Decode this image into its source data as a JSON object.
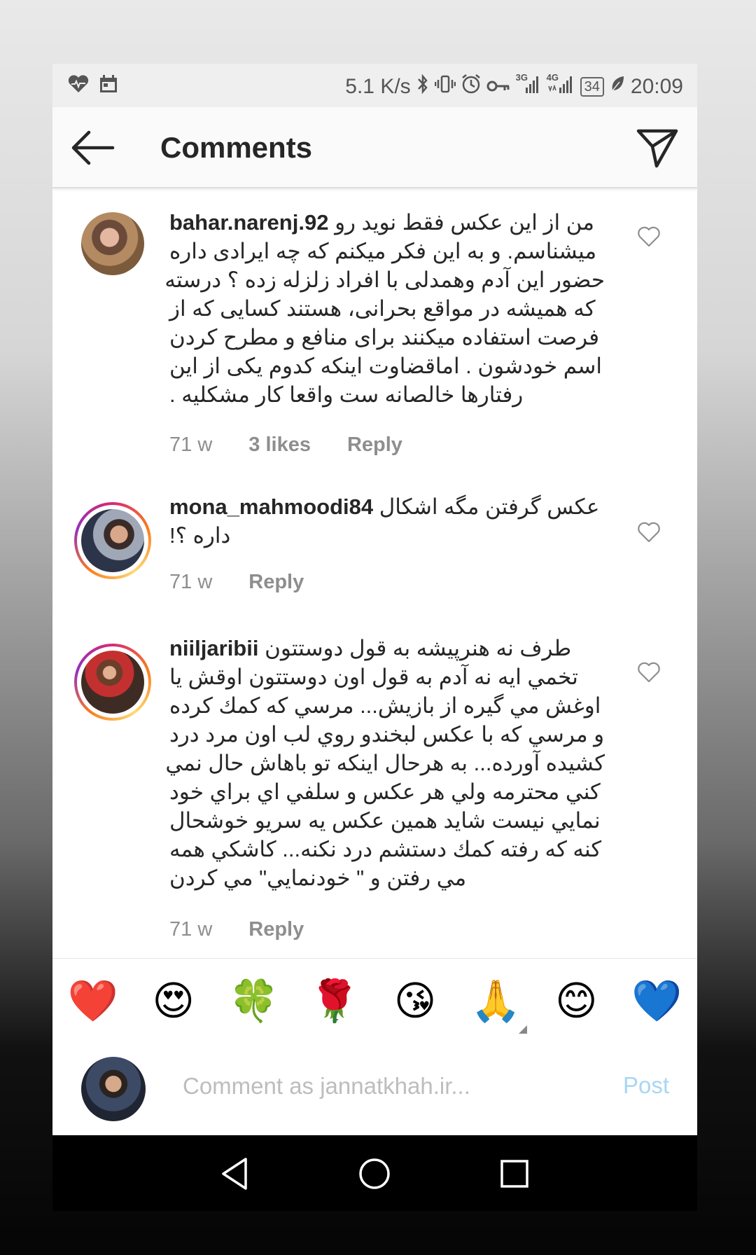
{
  "status_bar": {
    "speed": "5.1 K/s",
    "network_3g": "3G",
    "network_4g": "4G",
    "battery": "34",
    "time": "20:09"
  },
  "header": {
    "title": "Comments"
  },
  "comments": [
    {
      "username": "bahar.narenj.92",
      "lines": [
        "من از این عکس فقط نوید رو",
        "میشناسم. و به این فکر میکنم که چه ایرادی داره",
        "حضور این آدم وهمدلی با افراد زلزله زده ؟ درسته",
        "که همیشه در مواقع بحرانی، هستند کسایی که از",
        "فرصت استفاده میکنند برای منافع  و مطرح کردن",
        "اسم خودشون . اماقضاوت اینکه کدوم یکی از این",
        "رفتارها خالصانه ست واقعا کار مشکلیه ."
      ],
      "time": "71 w",
      "likes": "3 likes",
      "reply": "Reply"
    },
    {
      "username": "mona_mahmoodi84",
      "lines": [
        "عکس گرفتن مگه اشکال",
        "داره ؟!"
      ],
      "time": "71 w",
      "reply": "Reply"
    },
    {
      "username": "niiljaribii",
      "lines": [
        "طرف نه هنرپیشه به قول دوستتون",
        "تخمي ايه نه آدم به قول اون دوستتون اوقش يا",
        "اوغش مي گيره از بازيش... مرسي كه كمك كرده",
        "و مرسي كه با عكس لبخندو روي لب اون مرد درد",
        "كشيده آورده... به هرحال اينكه تو باهاش حال نمي",
        "كني محترمه ولي هر عكس و سلفي اي براي خود",
        "نمايي نيست شايد همين عكس يه سريو خوشحال",
        "كنه كه رفته كمك دستشم درد نكنه... كاشكي همه",
        "مي رفتن و \" خودنمايي\" مي كردن"
      ],
      "time": "71 w",
      "reply": "Reply"
    }
  ],
  "reactions": [
    "❤️",
    "😍",
    "🍀",
    "🌹",
    "😘",
    "🙏",
    "😊",
    "💙"
  ],
  "composer": {
    "placeholder": "Comment as jannatkhah.ir...",
    "post_label": "Post"
  },
  "colors": {
    "text": "#262626",
    "meta": "#8e8e8e",
    "post_disabled": "#a8d6f5"
  },
  "icons": {
    "back": "arrow-left-icon",
    "send": "paper-plane-icon",
    "like": "heart-outline-icon"
  }
}
